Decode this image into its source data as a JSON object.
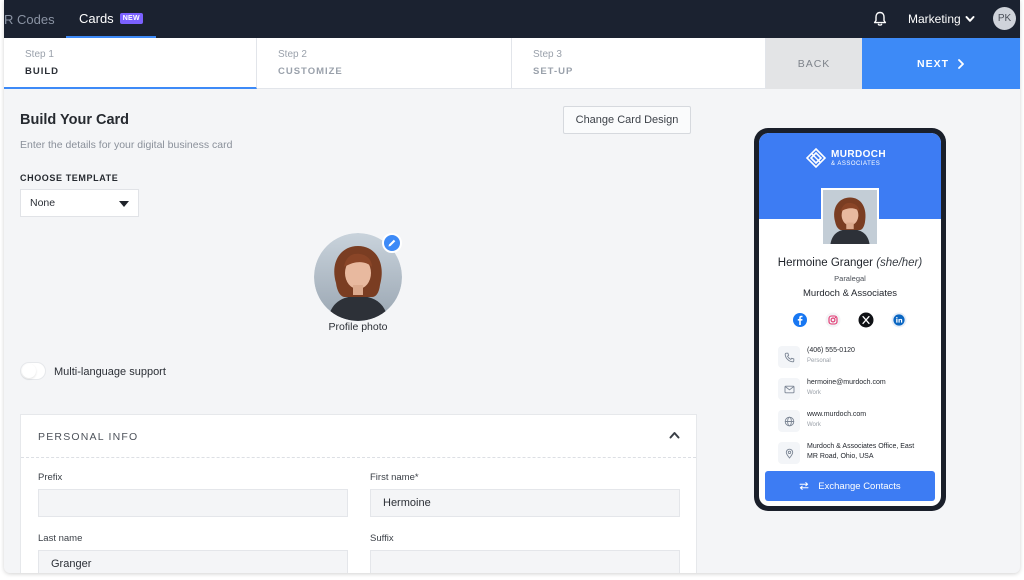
{
  "nav": {
    "prev_tab_label": "R Codes",
    "active_tab_label": "Cards",
    "active_tab_badge": "NEW",
    "org_name": "Marketing",
    "user_initials": "PK"
  },
  "stepper": {
    "steps": [
      {
        "num": "Step 1",
        "name": "BUILD"
      },
      {
        "num": "Step 2",
        "name": "CUSTOMIZE"
      },
      {
        "num": "Step 3",
        "name": "SET-UP"
      }
    ],
    "back_label": "BACK",
    "next_label": "NEXT"
  },
  "build": {
    "title": "Build Your Card",
    "subtitle": "Enter the details for your digital business card",
    "change_design_label": "Change Card Design",
    "template_label": "CHOOSE TEMPLATE",
    "template_value": "None",
    "profile_photo_label": "Profile photo",
    "multilang_label": "Multi-language support",
    "multilang_enabled": false
  },
  "personal_info": {
    "heading": "PERSONAL INFO",
    "fields": {
      "prefix": {
        "label": "Prefix",
        "value": ""
      },
      "first_name": {
        "label": "First name*",
        "value": "Hermoine"
      },
      "last_name": {
        "label": "Last name",
        "value": "Granger"
      },
      "suffix": {
        "label": "Suffix",
        "value": ""
      }
    }
  },
  "preview": {
    "logo_line1": "MURDOCH",
    "logo_line2": "& ASSOCIATES",
    "name": "Hermoine Granger",
    "pronouns": "(she/her)",
    "role": "Paralegal",
    "company": "Murdoch & Associates",
    "socials": [
      "facebook-icon",
      "instagram-icon",
      "x-icon",
      "linkedin-icon"
    ],
    "contacts": [
      {
        "icon": "phone-icon",
        "value": "(406) 555-0120",
        "type": "Personal"
      },
      {
        "icon": "mail-icon",
        "value": "hermoine@murdoch.com",
        "type": "Work"
      },
      {
        "icon": "globe-icon",
        "value": "www.murdoch.com",
        "type": "Work"
      },
      {
        "icon": "location-icon",
        "value_line1": "Murdoch & Associates Office, East",
        "value_line2": "MR Road, Ohio, USA"
      }
    ],
    "exchange_label": "Exchange Contacts"
  },
  "colors": {
    "nav_bg": "#1b2230",
    "accent": "#3d8af7",
    "card_blue": "#3d7cf3",
    "badge": "#7b61ff"
  }
}
